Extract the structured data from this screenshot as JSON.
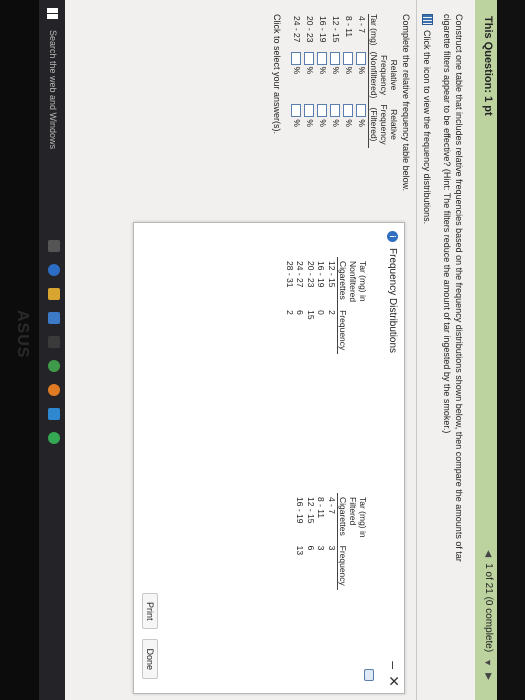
{
  "header": {
    "title": "This Question: 1 pt",
    "progress": "1 of 21 (0 complete)",
    "colors": {
      "bar": "#bcd3a0"
    }
  },
  "instructions": {
    "line1": "Construct one table that includes relative frequencies based on the frequency distributions shown below, then compare the amounts of tar",
    "line2": "cigarette filters appear to be effective? (Hint: The filters reduce the amount of tar ingested by the smoker.)",
    "icon_text": "Click the icon to view the frequency distributions."
  },
  "left_table": {
    "intro": "Complete the relative frequency table below.",
    "col1": "Tar (mg)",
    "col2_l1": "Relative",
    "col2_l2": "Frequency",
    "col2_l3": "(Nonfiltered)",
    "col3_l1": "Relative",
    "col3_l2": "Frequency",
    "col3_l3": "(Filtered)",
    "rows": [
      {
        "range": "4 - 7",
        "unit": "%"
      },
      {
        "range": "8 - 11",
        "unit": "%"
      },
      {
        "range": "12 - 15",
        "unit": "%"
      },
      {
        "range": "16 - 19",
        "unit": "%"
      },
      {
        "range": "20 - 23",
        "unit": "%"
      },
      {
        "range": "24 - 27",
        "unit": "%"
      }
    ],
    "select_hint": "Click to select your answer(s)."
  },
  "popup": {
    "title": "Frequency Distributions",
    "nonfiltered": {
      "h1": "Tar (mg) in",
      "h2": "Nonfiltered",
      "h3": "Cigarettes",
      "hfreq": "Frequency",
      "rows": [
        {
          "range": "12 - 15",
          "freq": "2"
        },
        {
          "range": "16 - 19",
          "freq": "0"
        },
        {
          "range": "20 - 23",
          "freq": "15"
        },
        {
          "range": "24 - 27",
          "freq": "6"
        },
        {
          "range": "28 - 31",
          "freq": "2"
        }
      ]
    },
    "filtered": {
      "h1": "Tar (mg) in",
      "h2": "Filtered",
      "h3": "Cigarettes",
      "hfreq": "Frequency",
      "rows": [
        {
          "range": "4 - 7",
          "freq": "3"
        },
        {
          "range": "8 - 11",
          "freq": "3"
        },
        {
          "range": "12 - 15",
          "freq": "6"
        },
        {
          "range": "16 - 19",
          "freq": "13"
        }
      ]
    },
    "print": "Print",
    "done": "Done"
  },
  "taskbar": {
    "search": "Search the web and Windows"
  },
  "brand": "ASUS"
}
